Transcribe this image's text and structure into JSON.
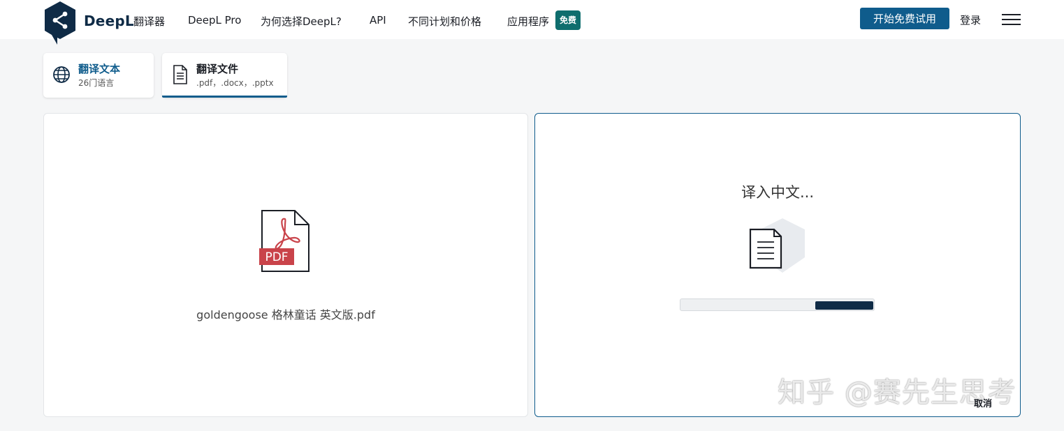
{
  "header": {
    "brand": "DeepL",
    "brand_sub": "翻译器",
    "nav": [
      "DeepL Pro",
      "为何选择DeepL?",
      "API",
      "不同计划和价格",
      "应用程序"
    ],
    "badge": "免费",
    "cta": "开始免费试用",
    "login": "登录"
  },
  "tabs": [
    {
      "title": "翻译文本",
      "sub": "26门语言",
      "icon": "globe-icon"
    },
    {
      "title": "翻译文件",
      "sub": ".pdf，.docx，.pptx",
      "icon": "document-icon",
      "active": true
    }
  ],
  "source": {
    "file_label": "PDF",
    "filename": "goldengoose 格林童话 英文版.pdf"
  },
  "target": {
    "status": "译入中文...",
    "progress": 0.3,
    "cancel": "取消"
  },
  "watermark": "知乎 @赛先生思考",
  "colors": {
    "brand": "#0f2b46",
    "accent": "#0f5c8c",
    "badge": "#0f6e6e",
    "pdf_red": "#c9434a"
  }
}
